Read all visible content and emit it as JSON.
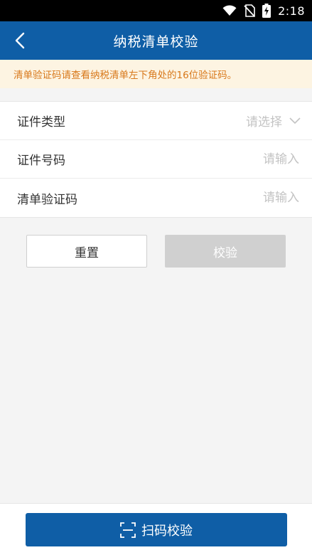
{
  "status_bar": {
    "time": "2:18",
    "icons": [
      "wifi-icon",
      "no-sim-icon",
      "battery-charging-icon"
    ]
  },
  "header": {
    "title": "纳税清单校验",
    "back_icon": "chevron-left-icon"
  },
  "notice": {
    "text": "清单验证码请查看纳税清单左下角处的16位验证码。"
  },
  "form": {
    "cert_type": {
      "label": "证件类型",
      "placeholder": "请选择",
      "icon": "chevron-down-icon"
    },
    "cert_number": {
      "label": "证件号码",
      "placeholder": "请输入",
      "value": ""
    },
    "verify_code": {
      "label": "清单验证码",
      "placeholder": "请输入",
      "value": ""
    }
  },
  "actions": {
    "reset_label": "重置",
    "verify_label": "校验"
  },
  "bottom": {
    "scan_label": "扫码校验",
    "scan_icon": "scan-frame-icon"
  },
  "colors": {
    "primary": "#0f5ea6",
    "notice_bg": "#fdf4e2",
    "notice_text": "#d8781a",
    "disabled_button": "#d0d0d0",
    "background": "#f4f4f4"
  }
}
